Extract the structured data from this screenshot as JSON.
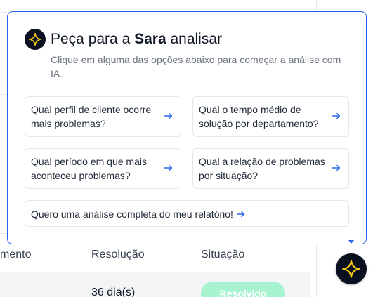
{
  "table": {
    "columns": [
      "mento",
      "Resolução",
      "Situação"
    ],
    "row": {
      "resolution": "36 dia(s)",
      "status": "Resolvido"
    }
  },
  "assistant": {
    "title_prefix": "Peça para a ",
    "title_name": "Sara",
    "title_suffix": " analisar",
    "subtitle": "Clique em alguma das opções abaixo para começar a análise com IA.",
    "options": [
      {
        "label": "Qual perfil de cliente ocorre mais problemas?"
      },
      {
        "label": "Qual o tempo médio de solução por departamento?"
      },
      {
        "label": "Qual período em que mais aconteceu problemas?"
      },
      {
        "label": "Qual a relação de problemas por situação?"
      },
      {
        "label": "Quero uma análise completa do meu relatório!"
      }
    ],
    "icon": "sparkle-icon",
    "accent_color": "#2563eb",
    "icon_color": "#facc15"
  }
}
